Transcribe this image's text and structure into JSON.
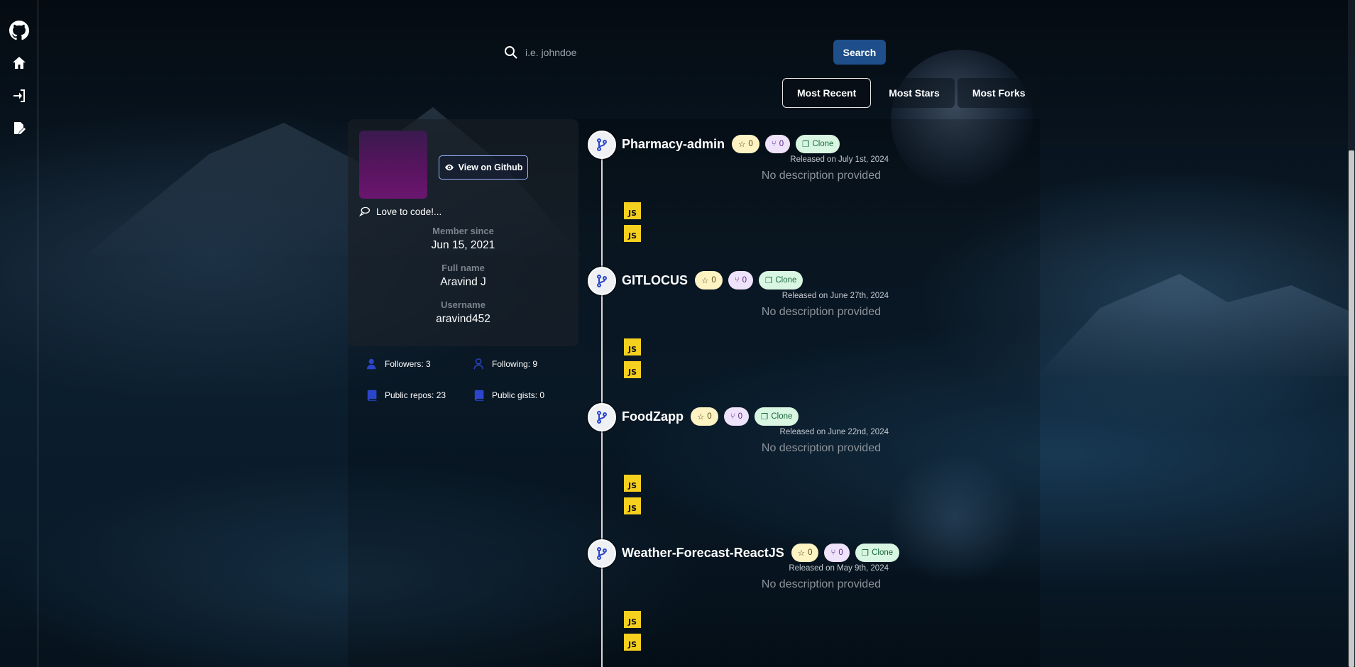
{
  "search": {
    "placeholder": "i.e. johndoe",
    "button_label": "Search"
  },
  "sort_tabs": [
    {
      "label": "Most Recent",
      "active": true
    },
    {
      "label": "Most Stars",
      "active": false
    },
    {
      "label": "Most Forks",
      "active": false
    }
  ],
  "nav": {
    "items": [
      {
        "icon": "github-icon"
      },
      {
        "icon": "home-icon"
      },
      {
        "icon": "login-icon"
      },
      {
        "icon": "signup-icon"
      }
    ]
  },
  "profile": {
    "view_button": "View on Github",
    "bio": "Love to code!...",
    "member_since_label": "Member since",
    "member_since": "Jun 15, 2021",
    "full_name_label": "Full name",
    "full_name": "Aravind J",
    "username_label": "Username",
    "username": "aravind452"
  },
  "stats": {
    "followers": "Followers: 3",
    "following": "Following: 9",
    "public_repos": "Public repos: 23",
    "public_gists": "Public gists: 0"
  },
  "repos": [
    {
      "name": "Pharmacy-admin",
      "stars": "0",
      "forks": "0",
      "clone": "Clone",
      "released": "Released on July 1st, 2024",
      "description": "No description provided",
      "langs": [
        "JS",
        "JS"
      ]
    },
    {
      "name": "GITLOCUS",
      "stars": "0",
      "forks": "0",
      "clone": "Clone",
      "released": "Released on June 27th, 2024",
      "description": "No description provided",
      "langs": [
        "JS",
        "JS"
      ]
    },
    {
      "name": "FoodZapp",
      "stars": "0",
      "forks": "0",
      "clone": "Clone",
      "released": "Released on June 22nd, 2024",
      "description": "No description provided",
      "langs": [
        "JS",
        "JS"
      ]
    },
    {
      "name": "Weather-Forecast-ReactJS",
      "stars": "0",
      "forks": "0",
      "clone": "Clone",
      "released": "Released on May 9th, 2024",
      "description": "No description provided",
      "langs": [
        "JS",
        "JS"
      ]
    }
  ],
  "colors": {
    "search_button": "#1e4f8a",
    "star_pill": "#fdf3c3",
    "fork_pill": "#efe2fb",
    "clone_pill": "#d9f6e2",
    "js_badge": "#f5d01f",
    "stat_icon": "#2b46c9"
  }
}
